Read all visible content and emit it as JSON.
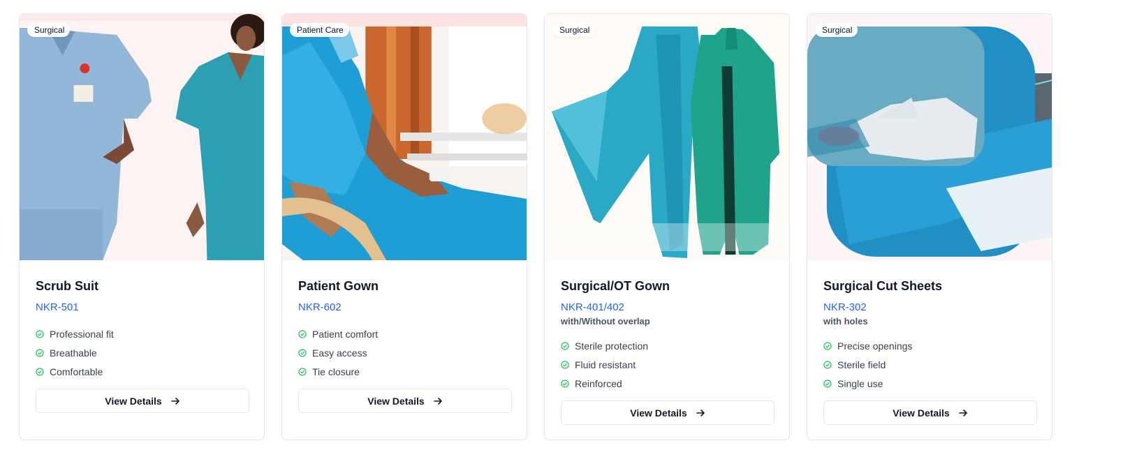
{
  "products": [
    {
      "badge": "Surgical",
      "title": "Scrub Suit",
      "code": "NKR-501",
      "subtitle": "",
      "features": [
        "Professional fit",
        "Breathable",
        "Comfortable"
      ],
      "cta": "View Details",
      "image": "scrub-suit-photo"
    },
    {
      "badge": "Patient Care",
      "title": "Patient Gown",
      "code": "NKR-602",
      "subtitle": "",
      "features": [
        "Patient comfort",
        "Easy access",
        "Tie closure"
      ],
      "cta": "View Details",
      "image": "patient-gown-photo"
    },
    {
      "badge": "Surgical",
      "title": "Surgical/OT Gown",
      "code": "NKR-401/402",
      "subtitle": "with/Without overlap",
      "features": [
        "Sterile protection",
        "Fluid resistant",
        "Reinforced"
      ],
      "cta": "View Details",
      "image": "ot-gown-photo"
    },
    {
      "badge": "Surgical",
      "title": "Surgical Cut Sheets",
      "code": "NKR-302",
      "subtitle": "with holes",
      "features": [
        "Precise openings",
        "Sterile field",
        "Single use"
      ],
      "cta": "View Details",
      "image": "cut-sheets-photo"
    }
  ],
  "colors": {
    "accent": "#2563eb",
    "check": "#22c55e",
    "scrub_blue": "#8fb6d9",
    "teal": "#2a9db0",
    "gown_blue": "#1f9ed6",
    "green_gown": "#1fa38a"
  }
}
